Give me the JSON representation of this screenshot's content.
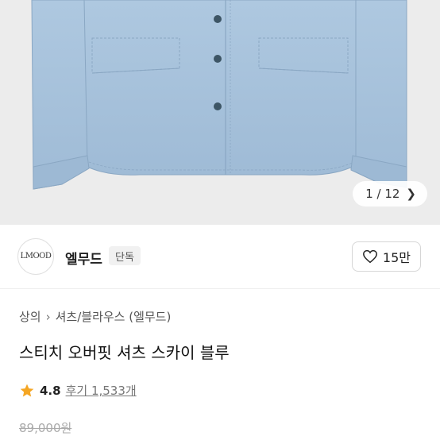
{
  "gallery": {
    "counter": "1 / 12",
    "next_icon": "chevron-right-icon"
  },
  "brand": {
    "logo_text": "LMOOD",
    "name": "엘무드",
    "badge": "단독"
  },
  "like": {
    "icon": "heart-icon",
    "count": "15만"
  },
  "breadcrumb": {
    "items": [
      "상의",
      "셔츠/블라우스 (엘무드)"
    ]
  },
  "product": {
    "title": "스티치 오버핏 셔츠 스카이 블루",
    "rating": "4.8",
    "reviews": "후기 1,533개",
    "price": "89,000원"
  },
  "colors": {
    "shirt": "#a9c3dc",
    "star": "#f5a623"
  }
}
